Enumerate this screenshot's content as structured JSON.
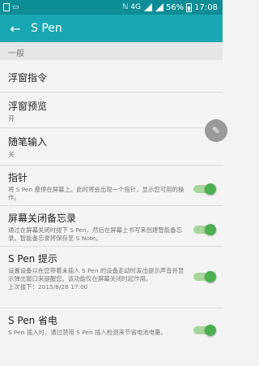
{
  "status_bar": {
    "signal_label": "4G",
    "battery_percent": "56%",
    "time": "17:08"
  },
  "header": {
    "back_icon": "arrow-left-icon",
    "title": "S Pen"
  },
  "section": {
    "general_label": "一般"
  },
  "items": [
    {
      "title": "浮窗指令",
      "sub": ""
    },
    {
      "title": "浮窗预览",
      "sub": "开"
    },
    {
      "title": "随笔输入",
      "sub": "关"
    },
    {
      "title": "指针",
      "desc": "将 S Pen 悬停在屏幕上。此时将会出现一个指针，显示您可用的操作。",
      "toggle": "on"
    },
    {
      "title": "屏幕关闭备忘录",
      "desc": "通过在屏幕关闭时拔下 S Pen，然后在屏幕上书写来创建智能备忘录。智能备忘录将保存至 S Note。",
      "toggle": "on"
    },
    {
      "title": "S Pen 提示",
      "desc": "设置设备以在您带着未插入 S Pen 的设备走动时发出提示声音并显示弹出窗口来提醒您。该功能仅在屏幕关闭时起作用。",
      "extra": "上次拔下：2015/8/28 17:00",
      "toggle": "on"
    },
    {
      "title": "S Pen 省电",
      "desc": "S Pen 插入时，通过禁用 S Pen 插入检测来节省电池电量。",
      "toggle": "on"
    }
  ],
  "colors": {
    "status_bar": "#0e8d97",
    "app_bar": "#19a8b3",
    "toggle_on": "#4caf50"
  },
  "floating_button_icon": "pencil-icon"
}
